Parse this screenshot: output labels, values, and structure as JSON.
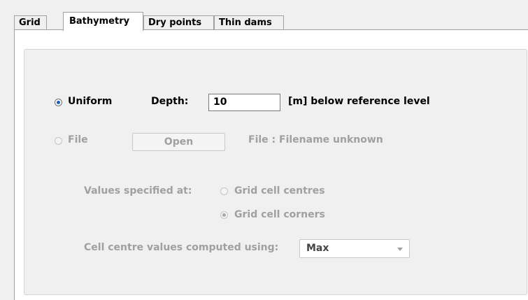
{
  "tabs": [
    {
      "label": "Grid"
    },
    {
      "label": "Bathymetry",
      "active": true
    },
    {
      "label": "Dry points"
    },
    {
      "label": "Thin dams"
    }
  ],
  "uniform": {
    "label": "Uniform",
    "selected": true
  },
  "depth": {
    "label": "Depth:",
    "value": "10",
    "unit": "[m] below reference level"
  },
  "file": {
    "label": "File",
    "selected": false,
    "open_button": "Open",
    "file_label": "File :  Filename unknown"
  },
  "values_specified": {
    "label": "Values specified at:",
    "options": [
      {
        "label": "Grid cell centres",
        "selected": false
      },
      {
        "label": "Grid cell corners",
        "selected": true
      }
    ]
  },
  "cell_centre": {
    "label": "Cell centre values computed using:",
    "value": "Max"
  },
  "colors": {
    "radio_selected": "#1a5fb4",
    "disabled_text": "#a0a0a0"
  }
}
